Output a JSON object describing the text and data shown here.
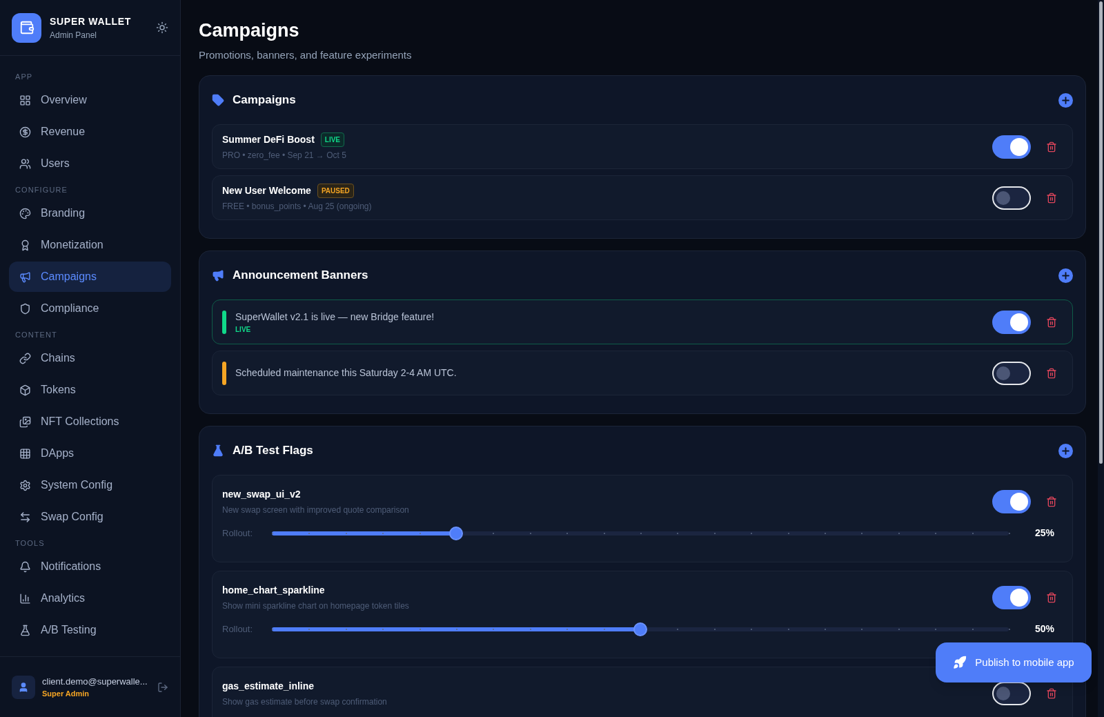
{
  "brand": {
    "title": "SUPER WALLET",
    "subtitle": "Admin Panel"
  },
  "nav": [
    {
      "heading": "APP",
      "items": [
        {
          "label": "Overview",
          "selected": false
        },
        {
          "label": "Revenue",
          "selected": false
        },
        {
          "label": "Users",
          "selected": false
        }
      ]
    },
    {
      "heading": "CONFIGURE",
      "items": [
        {
          "label": "Branding",
          "selected": false
        },
        {
          "label": "Monetization",
          "selected": false
        },
        {
          "label": "Campaigns",
          "selected": true
        },
        {
          "label": "Compliance",
          "selected": false
        }
      ]
    },
    {
      "heading": "CONTENT",
      "items": [
        {
          "label": "Chains",
          "selected": false
        },
        {
          "label": "Tokens",
          "selected": false
        },
        {
          "label": "NFT Collections",
          "selected": false
        },
        {
          "label": "DApps",
          "selected": false
        },
        {
          "label": "System Config",
          "selected": false
        },
        {
          "label": "Swap Config",
          "selected": false
        }
      ]
    },
    {
      "heading": "TOOLS",
      "items": [
        {
          "label": "Notifications",
          "selected": false
        },
        {
          "label": "Analytics",
          "selected": false
        },
        {
          "label": "A/B Testing",
          "selected": false
        }
      ]
    }
  ],
  "user": {
    "email": "client.demo@superwalle...",
    "role": "Super Admin"
  },
  "page": {
    "title": "Campaigns",
    "subtitle": "Promotions, banners, and feature experiments"
  },
  "campaigns": {
    "title": "Campaigns",
    "items": [
      {
        "name": "Summer DeFi Boost",
        "status": "LIVE",
        "kind": "live",
        "meta": "PRO • zero_fee • Sep 21 → Oct 5",
        "on": true
      },
      {
        "name": "New User Welcome",
        "status": "PAUSED",
        "kind": "paused",
        "meta": "FREE • bonus_points • Aug 25 (ongoing)",
        "on": false
      }
    ]
  },
  "banners": {
    "title": "Announcement Banners",
    "items": [
      {
        "text": "SuperWallet v2.1 is live — new Bridge feature!",
        "badge": "LIVE",
        "color": "#10d98a",
        "on": true
      },
      {
        "text": "Scheduled maintenance this Saturday 2-4 AM UTC.",
        "color": "#f5a524",
        "on": false
      }
    ]
  },
  "flags": {
    "title": "A/B Test Flags",
    "items": [
      {
        "name": "new_swap_ui_v2",
        "description": "New swap screen with improved quote comparison",
        "on": true,
        "rollout_label": "Rollout:",
        "level": 0.25,
        "reading": "25%"
      },
      {
        "name": "home_chart_sparkline",
        "description": "Show mini sparkline chart on homepage token tiles",
        "on": true,
        "rollout_label": "Rollout:",
        "level": 0.5,
        "reading": "50%"
      },
      {
        "name": "gas_estimate_inline",
        "description": "Show gas estimate before swap confirmation",
        "on": false
      }
    ]
  },
  "publish": {
    "label": "Publish to mobile app"
  }
}
